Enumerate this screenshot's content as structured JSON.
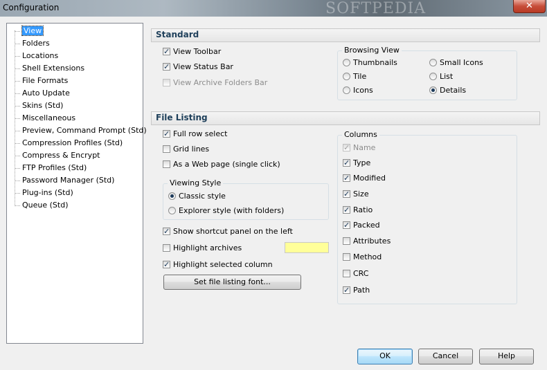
{
  "window": {
    "title": "Configuration",
    "close_glyph": "✕",
    "watermark": "SOFTPEDIA"
  },
  "tree": {
    "items": [
      {
        "label": "View",
        "selected": true
      },
      {
        "label": "Folders"
      },
      {
        "label": "Locations"
      },
      {
        "label": "Shell Extensions"
      },
      {
        "label": "File Formats"
      },
      {
        "label": "Auto Update"
      },
      {
        "label": "Skins (Std)"
      },
      {
        "label": "Miscellaneous"
      },
      {
        "label": "Preview, Command Prompt (Std)"
      },
      {
        "label": "Compression Profiles (Std)"
      },
      {
        "label": "Compress & Encrypt"
      },
      {
        "label": "FTP Profiles (Std)"
      },
      {
        "label": "Password Manager (Std)"
      },
      {
        "label": "Plug-ins (Std)"
      },
      {
        "label": "Queue (Std)"
      }
    ]
  },
  "standard": {
    "header": "Standard",
    "view_toolbar": {
      "label": "View Toolbar",
      "checked": true
    },
    "view_status_bar": {
      "label": "View Status Bar",
      "checked": true
    },
    "view_archive_folders_bar": {
      "label": "View Archive Folders Bar",
      "checked": false,
      "disabled": true
    },
    "browsing_view": {
      "label": "Browsing View",
      "options": {
        "thumbnails": "Thumbnails",
        "small_icons": "Small Icons",
        "tile": "Tile",
        "list": "List",
        "icons": "Icons",
        "details": "Details"
      },
      "selected": "Details"
    }
  },
  "file_listing": {
    "header": "File Listing",
    "full_row_select": {
      "label": "Full row select",
      "checked": true
    },
    "grid_lines": {
      "label": "Grid lines",
      "checked": false
    },
    "as_web_page": {
      "label": "As a Web page (single click)",
      "checked": false
    },
    "viewing_style": {
      "label": "Viewing Style",
      "classic": "Classic style",
      "explorer": "Explorer style (with folders)",
      "selected": "Classic style"
    },
    "show_shortcut_panel": {
      "label": "Show shortcut panel on the left",
      "checked": true
    },
    "highlight_archives": {
      "label": "Highlight archives",
      "checked": false,
      "color": "#ffff99"
    },
    "highlight_selected_column": {
      "label": "Highlight selected column",
      "checked": true
    },
    "set_font_button": "Set file listing font...",
    "columns": {
      "label": "Columns",
      "name": {
        "label": "Name",
        "checked": true,
        "disabled": true
      },
      "type": {
        "label": "Type",
        "checked": true
      },
      "modified": {
        "label": "Modified",
        "checked": true
      },
      "size": {
        "label": "Size",
        "checked": true
      },
      "ratio": {
        "label": "Ratio",
        "checked": true
      },
      "packed": {
        "label": "Packed",
        "checked": true
      },
      "attributes": {
        "label": "Attributes",
        "checked": false
      },
      "method": {
        "label": "Method",
        "checked": false
      },
      "crc": {
        "label": "CRC",
        "checked": false
      },
      "path": {
        "label": "Path",
        "checked": true
      }
    }
  },
  "buttons": {
    "ok": "OK",
    "cancel": "Cancel",
    "help": "Help"
  }
}
